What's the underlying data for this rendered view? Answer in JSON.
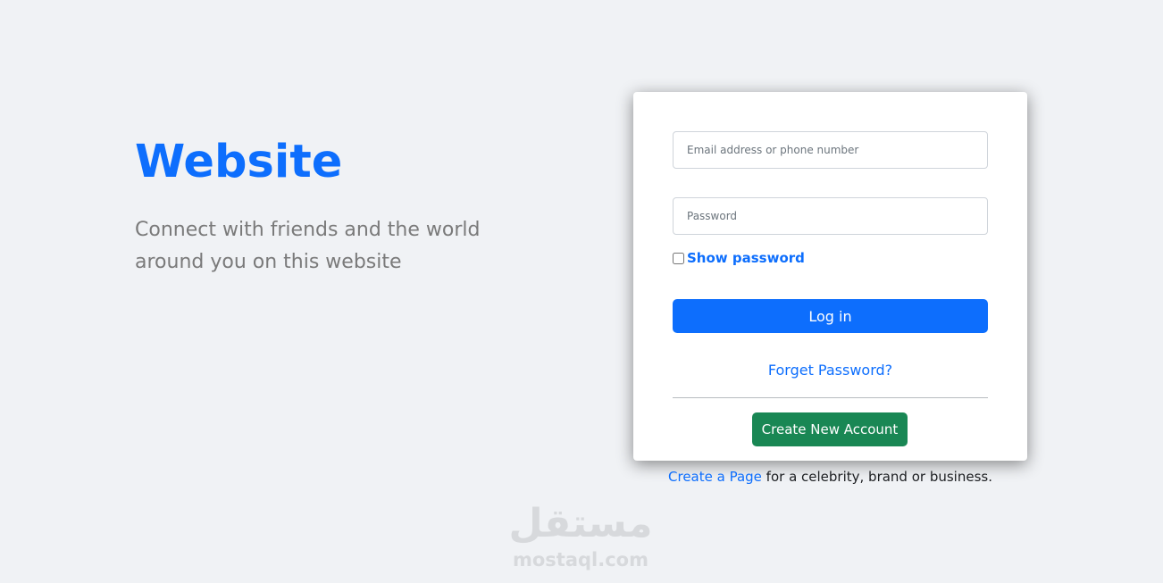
{
  "brand": {
    "title": "Website",
    "tagline": "Connect with friends and the world around you on this website"
  },
  "login": {
    "email_placeholder": "Email address or phone number",
    "password_placeholder": "Password",
    "show_password_label": "Show password",
    "login_button": "Log in",
    "forget_password": "Forget Password?",
    "create_account_button": "Create New Account"
  },
  "footer": {
    "create_page_link": "Create a Page",
    "create_page_text": " for a celebrity, brand or business."
  },
  "watermark": {
    "arabic": "مستقل",
    "latin": "mostaql.com"
  },
  "colors": {
    "background": "#f0f2f5",
    "primary": "#0d6efd",
    "success": "#198754"
  }
}
